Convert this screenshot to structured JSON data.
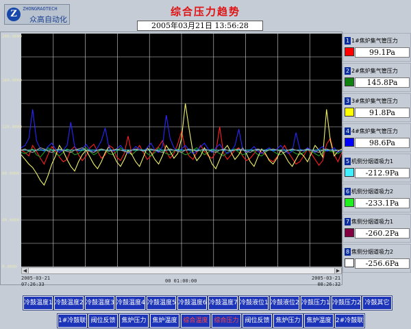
{
  "header": {
    "logo_icon": "Z",
    "logo_text_en": "ZHONGRAOTECH",
    "logo_text_cn": "众高自动化",
    "title": "综合压力趋势",
    "datetime": "2005年03月21日  13:56:28"
  },
  "chart": {
    "y_tick_labels": [
      "200.0000",
      "160.0000",
      "120.0000",
      "80.0000",
      "40.0000",
      "0.0000"
    ],
    "x_left_date": "2005-03-21",
    "x_left_time": "07:26:33",
    "x_center_label": "00 01:00:00",
    "x_right_date": "2005-03-21",
    "x_right_time": "08:26:32",
    "background": "#000000",
    "grid_color": "#d8d8d8"
  },
  "chart_data": {
    "type": "line",
    "ylim": [
      0,
      200
    ],
    "x_start": "2005-03-21 07:26:33",
    "x_end": "2005-03-21 08:26:32",
    "series": [
      {
        "color": "#ff2020",
        "values": [
          100,
          98,
          95,
          104,
          99,
          93,
          88,
          96,
          103,
          99,
          94,
          90,
          92,
          100,
          103,
          96,
          91,
          95,
          102,
          105,
          99,
          93,
          96,
          104,
          102,
          94,
          91,
          97,
          112,
          96,
          99,
          104,
          98,
          92,
          95,
          100,
          103,
          108,
          99,
          93,
          97,
          105,
          116,
          101,
          95,
          92,
          98,
          104,
          99,
          95,
          93,
          98,
          120,
          97,
          92,
          96,
          100,
          102,
          95,
          91,
          93,
          97,
          101,
          98,
          96,
          92,
          90,
          94,
          99,
          104,
          98,
          93,
          88,
          90,
          95,
          101,
          97,
          92,
          87,
          91,
          105,
          110,
          96,
          90,
          98
        ]
      },
      {
        "color": "#1f9e1f",
        "values": [
          98,
          97,
          99,
          101,
          96,
          94,
          98,
          102,
          100,
          97,
          95,
          98,
          101,
          99,
          96,
          97,
          100,
          102,
          99,
          96,
          98,
          101,
          100,
          97,
          96,
          99,
          102,
          100,
          98,
          96,
          99,
          101,
          100,
          97,
          95,
          98,
          102,
          99,
          97,
          96,
          99,
          101,
          98,
          96,
          97,
          100,
          102,
          99,
          96,
          98,
          101,
          99,
          97,
          95,
          98,
          100,
          101,
          98,
          96,
          97,
          100,
          99,
          96,
          95,
          98,
          101,
          99,
          97,
          96,
          98,
          100,
          99,
          97,
          96,
          98,
          101,
          99,
          97,
          95,
          98,
          100,
          99,
          98,
          97,
          99
        ]
      },
      {
        "color": "#f2f26a",
        "values": [
          96,
          92,
          88,
          85,
          80,
          74,
          70,
          78,
          88,
          95,
          104,
          99,
          92,
          86,
          82,
          90,
          96,
          100,
          94,
          88,
          84,
          90,
          98,
          103,
          97,
          90,
          86,
          92,
          100,
          96,
          90,
          86,
          94,
          102,
          98,
          92,
          88,
          95,
          104,
          99,
          93,
          97,
          110,
          140,
          118,
          98,
          91,
          95,
          102,
          96,
          88,
          84,
          92,
          100,
          104,
          98,
          92,
          96,
          102,
          97,
          90,
          86,
          94,
          101,
          97,
          91,
          88,
          93,
          100,
          96,
          90,
          86,
          92,
          98,
          95,
          90,
          97,
          104,
          100,
          94,
          135,
          108,
          95,
          99,
          101
        ]
      },
      {
        "color": "#2828ff",
        "values": [
          102,
          104,
          110,
          135,
          108,
          101,
          99,
          103,
          106,
          101,
          98,
          100,
          104,
          124,
          103,
          99,
          101,
          105,
          100,
          98,
          102,
          108,
          119,
          102,
          99,
          101,
          104,
          100,
          97,
          100,
          103,
          101,
          99,
          102,
          106,
          100,
          98,
          103,
          130,
          110,
          102,
          99,
          101,
          104,
          100,
          97,
          99,
          103,
          106,
          101,
          98,
          102,
          105,
          100,
          97,
          99,
          104,
          118,
          101,
          98,
          100,
          103,
          99,
          97,
          100,
          102,
          99,
          101,
          104,
          100,
          97,
          99,
          115,
          101,
          99,
          102,
          100,
          98,
          101,
          103,
          99,
          100,
          102,
          98,
          100
        ]
      },
      {
        "color": "#40f0ff",
        "values": [
          100,
          100,
          100,
          100,
          100,
          100,
          100,
          100,
          100,
          100,
          100,
          100,
          100,
          100,
          100,
          100,
          100,
          100,
          100,
          100,
          100,
          100,
          100,
          100,
          100,
          100,
          100,
          100,
          100,
          100,
          100,
          100,
          100,
          100,
          100,
          100,
          100,
          100,
          100,
          100,
          100,
          100,
          100,
          100,
          100,
          100,
          100,
          100,
          100,
          100,
          100,
          100,
          100,
          100,
          100,
          100,
          100,
          100,
          100,
          100,
          100,
          100,
          100,
          100,
          100,
          100,
          100,
          100,
          100,
          100,
          100,
          100,
          100,
          100,
          100,
          100,
          100,
          100,
          100,
          100,
          100,
          100,
          100,
          100,
          100
        ]
      },
      {
        "color": "#a0a0a0",
        "values": [
          100,
          101,
          99,
          98,
          100,
          102,
          101,
          99,
          98,
          100,
          101,
          100,
          99,
          98,
          100,
          101,
          102,
          100,
          99,
          98,
          100,
          101,
          100,
          99,
          100,
          101,
          100,
          99,
          98,
          100,
          101,
          100,
          99,
          100,
          101,
          100,
          99,
          98,
          100,
          101,
          100,
          99,
          98,
          100,
          101,
          100,
          99,
          100,
          101,
          100,
          99,
          98,
          100,
          101,
          100,
          99,
          100,
          101,
          100,
          99,
          98,
          100,
          101,
          100,
          99,
          100,
          101,
          100,
          99,
          98,
          100,
          101,
          100,
          99,
          100,
          101,
          100,
          99,
          98,
          100,
          101,
          100,
          99,
          100,
          100
        ]
      }
    ]
  },
  "pens": [
    {
      "index": "1",
      "name": "1#焦炉集气管压力",
      "value": "99.1Pa",
      "color": "#ff0000"
    },
    {
      "index": "2",
      "name": "2#焦炉集气管压力",
      "value": "145.8Pa",
      "color": "#108010"
    },
    {
      "index": "3",
      "name": "3#焦炉集气管压力",
      "value": "91.8Pa",
      "color": "#ffff00"
    },
    {
      "index": "4",
      "name": "4#焦炉集气管压力",
      "value": "98.6Pa",
      "color": "#0000ff"
    },
    {
      "index": "5",
      "name": "机侧分烟道吸力1",
      "value": "-212.9Pa",
      "color": "#40f0ff"
    },
    {
      "index": "6",
      "name": "机侧分烟道吸力2",
      "value": "-233.1Pa",
      "color": "#20f020"
    },
    {
      "index": "7",
      "name": "焦侧分烟道吸力1",
      "value": "-260.2Pa",
      "color": "#800040"
    },
    {
      "index": "8",
      "name": "焦侧分烟道吸力2",
      "value": "-256.6Pa",
      "color": "#ffffff"
    }
  ],
  "buttons_row1": [
    "冷鼓温度1",
    "冷鼓温度2",
    "冷鼓温度3",
    "冷鼓温度4",
    "冷鼓温度5",
    "冷鼓温度6",
    "冷鼓温度7",
    "冷鼓液位1",
    "冷鼓液位2",
    "冷鼓压力1",
    "冷鼓压力2",
    "冷鼓其它"
  ],
  "buttons_row2": [
    "1#冷鼓联锁",
    "阀位反馈",
    "焦炉压力",
    "焦炉温度",
    "综合温度",
    "综合压力",
    "阀位反馈",
    "焦炉压力",
    "焦炉温度",
    "2#冷鼓联锁"
  ],
  "buttons_row2_alert": [
    false,
    false,
    false,
    false,
    true,
    true,
    false,
    false,
    false,
    false
  ]
}
